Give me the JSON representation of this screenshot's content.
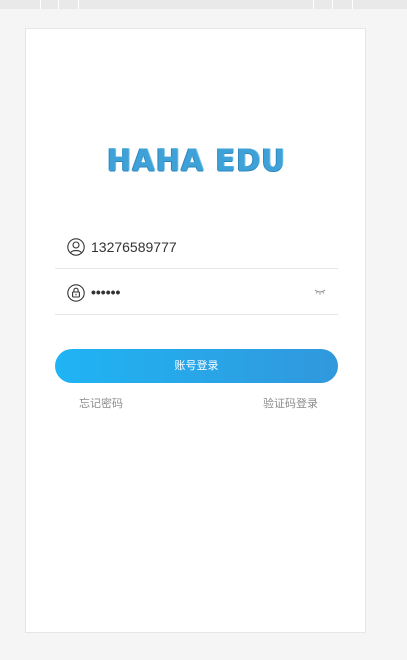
{
  "logo": {
    "text": "HAHA EDU"
  },
  "form": {
    "username_value": "13276589777",
    "password_value": "••••••"
  },
  "actions": {
    "login_label": "账号登录",
    "forgot_label": "忘记密码",
    "sms_login_label": "验证码登录"
  },
  "icons": {
    "user": "user-circle-icon",
    "lock": "lock-icon",
    "eye": "eye-closed-icon"
  },
  "colors": {
    "brand": "#3ea2d8",
    "button_start": "#1fb4f4",
    "button_end": "#3198dc"
  }
}
